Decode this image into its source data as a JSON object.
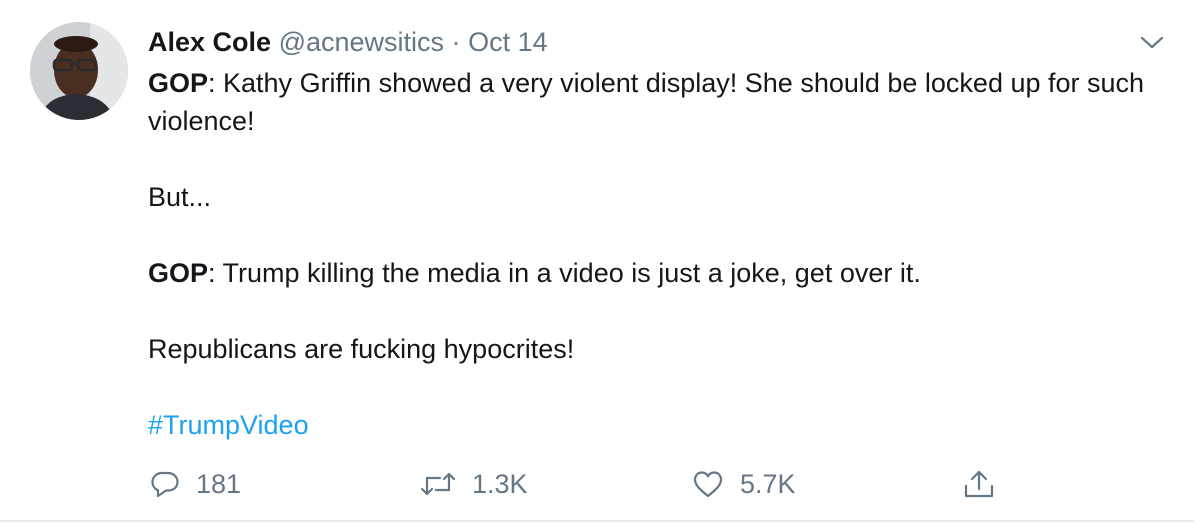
{
  "tweet": {
    "author_name": "Alex Cole",
    "handle": "@acnewsitics",
    "separator": "·",
    "date": "Oct 14",
    "body": {
      "line1_bold": "GOP",
      "line1_rest": ": Kathy Griffin showed a very violent display! She should be locked up for such violence!",
      "line2": "But...",
      "line3_bold": "GOP",
      "line3_rest": ": Trump killing the media in a video is just a joke, get over it.",
      "line4": "Republicans are fucking hypocrites!",
      "hashtag": "#TrumpVideo"
    },
    "actions": {
      "reply_count": "181",
      "retweet_count": "1.3K",
      "like_count": "5.7K"
    },
    "icons": {
      "reply": "reply-icon",
      "retweet": "retweet-icon",
      "like": "heart-icon",
      "share": "share-icon",
      "menu": "chevron-down-icon"
    },
    "colors": {
      "text": "#14171a",
      "secondary": "#657786",
      "link": "#1da1f2"
    }
  }
}
